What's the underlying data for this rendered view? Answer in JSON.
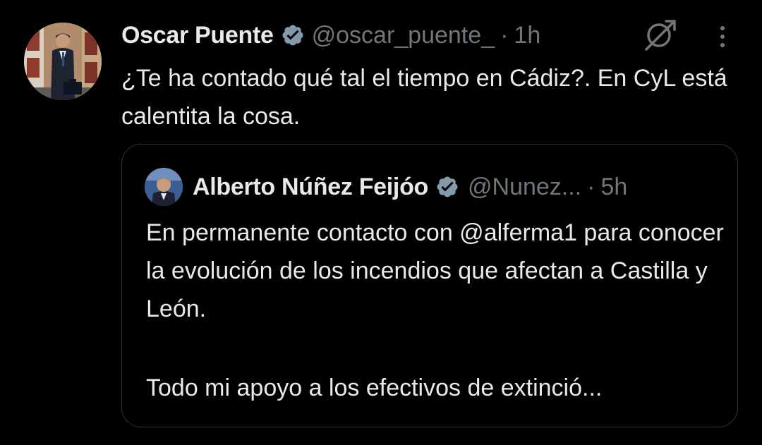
{
  "tweet": {
    "author": {
      "display_name": "Oscar Puente",
      "handle": "@oscar_puente_",
      "verified_icon": "verified-badge-icon"
    },
    "separator": "·",
    "time": "1h",
    "text": "¿Te ha contado qué tal el tiempo en Cádiz?. En CyL está calentita la cosa.",
    "grok_icon": "grok-icon",
    "more_icon": "more-options-icon"
  },
  "quoted_tweet": {
    "author": {
      "display_name": "Alberto Núñez Feijóo",
      "handle": "@Nunez...",
      "verified_icon": "verified-badge-icon"
    },
    "separator": "·",
    "time": "5h",
    "paragraph_1": "En permanente contacto con @alferma1 para conocer la evolución de los incendios que afectan a Castilla y León.",
    "paragraph_2": "Todo mi apoyo a los efectivos de extinció..."
  },
  "colors": {
    "background": "#000000",
    "text_primary": "#e7e9ea",
    "text_secondary": "#71767b",
    "verified_badge": "#829aab",
    "border": "#2f3336"
  }
}
